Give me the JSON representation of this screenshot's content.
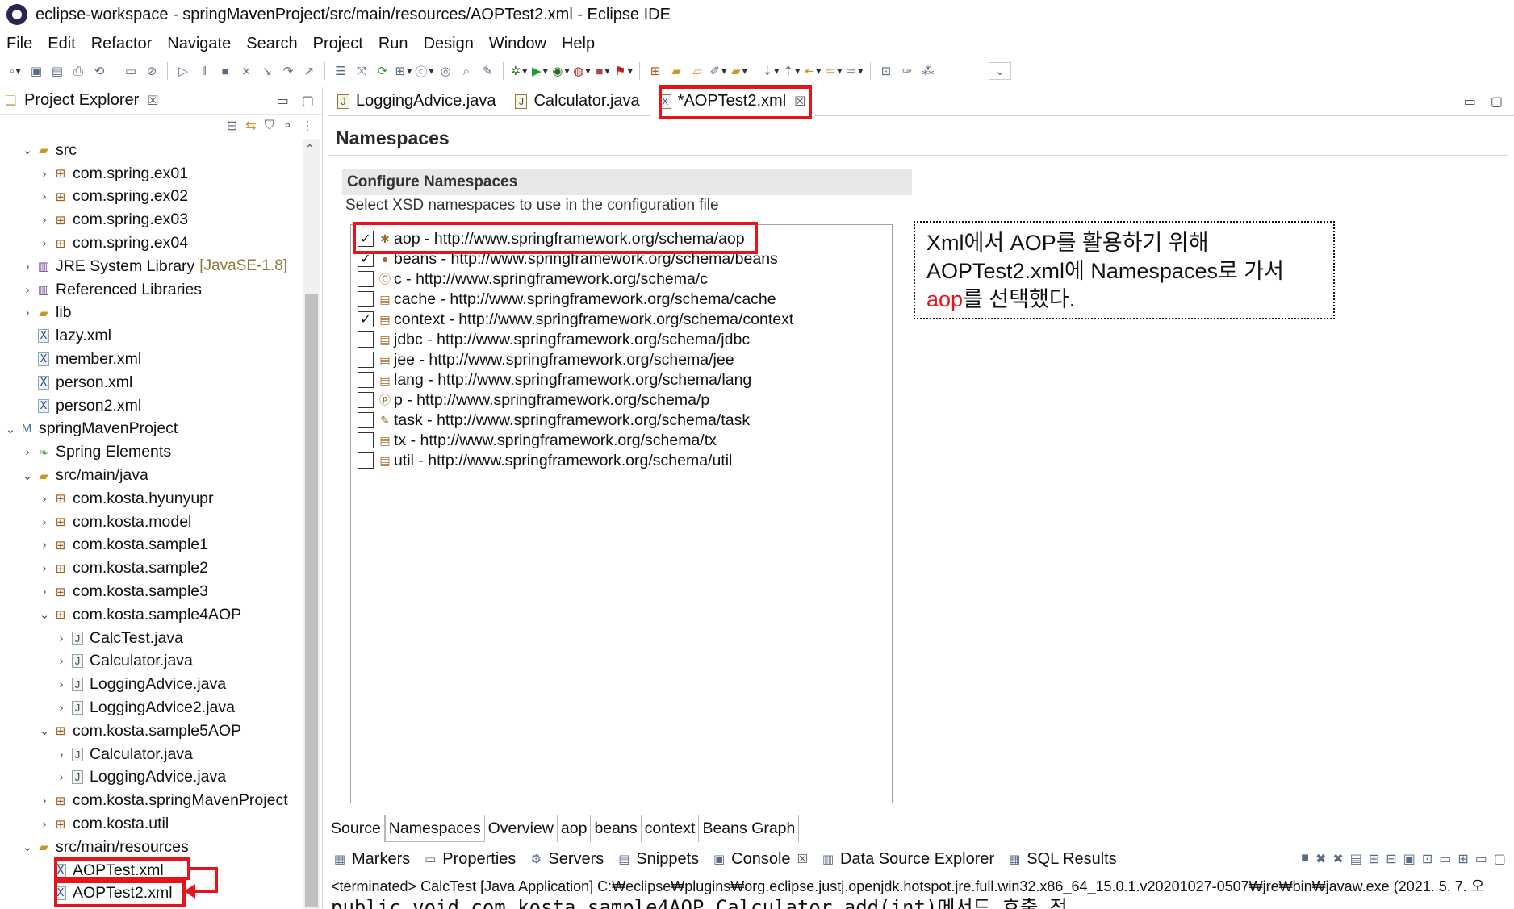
{
  "window": {
    "title": "eclipse-workspace - springMavenProject/src/main/resources/AOPTest2.xml - Eclipse IDE"
  },
  "menu": [
    "File",
    "Edit",
    "Refactor",
    "Navigate",
    "Search",
    "Project",
    "Run",
    "Design",
    "Window",
    "Help"
  ],
  "project_explorer": {
    "title": "Project Explorer",
    "close": "☒",
    "minimize": "▭",
    "maximize": "▢",
    "tree": [
      {
        "arrow": "⌄",
        "icon": "folder-icon",
        "label": "src",
        "level": 1
      },
      {
        "arrow": "›",
        "icon": "package-icon",
        "label": "com.spring.ex01",
        "level": 2
      },
      {
        "arrow": "›",
        "icon": "package-icon",
        "label": "com.spring.ex02",
        "level": 2
      },
      {
        "arrow": "›",
        "icon": "package-icon",
        "label": "com.spring.ex03",
        "level": 2
      },
      {
        "arrow": "›",
        "icon": "package-icon",
        "label": "com.spring.ex04",
        "level": 2
      },
      {
        "arrow": "›",
        "icon": "library-icon",
        "label": "JRE System Library",
        "deco": "[JavaSE-1.8]",
        "level": 1
      },
      {
        "arrow": "›",
        "icon": "library-icon",
        "label": "Referenced Libraries",
        "level": 1
      },
      {
        "arrow": "›",
        "icon": "folder-icon",
        "label": "lib",
        "level": 1
      },
      {
        "arrow": "",
        "icon": "xml-file-icon",
        "label": "lazy.xml",
        "level": 1
      },
      {
        "arrow": "",
        "icon": "xml-file-icon",
        "label": "member.xml",
        "level": 1
      },
      {
        "arrow": "",
        "icon": "xml-file-icon",
        "label": "person.xml",
        "level": 1
      },
      {
        "arrow": "",
        "icon": "xml-file-icon",
        "label": "person2.xml",
        "level": 1
      },
      {
        "arrow": "⌄",
        "icon": "project-icon",
        "label": "springMavenProject",
        "level": 0
      },
      {
        "arrow": "›",
        "icon": "spring-icon",
        "label": "Spring Elements",
        "level": 1
      },
      {
        "arrow": "⌄",
        "icon": "source-folder-icon",
        "label": "src/main/java",
        "level": 1
      },
      {
        "arrow": "›",
        "icon": "package-icon",
        "label": "com.kosta.hyunyupr",
        "level": 2
      },
      {
        "arrow": "›",
        "icon": "package-icon",
        "label": "com.kosta.model",
        "level": 2
      },
      {
        "arrow": "›",
        "icon": "package-icon",
        "label": "com.kosta.sample1",
        "level": 2
      },
      {
        "arrow": "›",
        "icon": "package-icon",
        "label": "com.kosta.sample2",
        "level": 2
      },
      {
        "arrow": "›",
        "icon": "package-icon",
        "label": "com.kosta.sample3",
        "level": 2
      },
      {
        "arrow": "⌄",
        "icon": "package-icon",
        "label": "com.kosta.sample4AOP",
        "level": 2
      },
      {
        "arrow": "›",
        "icon": "java-file-icon",
        "label": "CalcTest.java",
        "level": 3
      },
      {
        "arrow": "›",
        "icon": "java-file-icon",
        "label": "Calculator.java",
        "level": 3
      },
      {
        "arrow": "›",
        "icon": "java-file-icon",
        "label": "LoggingAdvice.java",
        "level": 3
      },
      {
        "arrow": "›",
        "icon": "java-file-icon",
        "label": "LoggingAdvice2.java",
        "level": 3
      },
      {
        "arrow": "⌄",
        "icon": "package-icon",
        "label": "com.kosta.sample5AOP",
        "level": 2
      },
      {
        "arrow": "›",
        "icon": "java-file-icon",
        "label": "Calculator.java",
        "level": 3
      },
      {
        "arrow": "›",
        "icon": "java-file-icon",
        "label": "LoggingAdvice.java",
        "level": 3
      },
      {
        "arrow": "›",
        "icon": "package-icon",
        "label": "com.kosta.springMavenProject",
        "level": 2
      },
      {
        "arrow": "›",
        "icon": "package-icon",
        "label": "com.kosta.util",
        "level": 2
      },
      {
        "arrow": "⌄",
        "icon": "source-folder-icon",
        "label": "src/main/resources",
        "level": 1
      },
      {
        "arrow": "",
        "icon": "xml-file-icon",
        "label": "AOPTest.xml",
        "level": 2
      },
      {
        "arrow": "",
        "icon": "xml-file-icon",
        "label": "AOPTest2.xml",
        "level": 2
      }
    ]
  },
  "editor": {
    "tabs": [
      {
        "label": "LoggingAdvice.java",
        "icon": "java-file-icon"
      },
      {
        "label": "Calculator.java",
        "icon": "java-file-icon"
      },
      {
        "label": "*AOPTest2.xml",
        "icon": "xml-file-icon",
        "close": "☒"
      }
    ],
    "minimize": "▭",
    "maximize": "▢",
    "page_title": "Namespaces",
    "section_title": "Configure Namespaces",
    "section_desc": "Select XSD namespaces to use in the configuration file",
    "namespaces": [
      {
        "checked": true,
        "icon": "aop-namespace-icon",
        "text": "aop - http://www.springframework.org/schema/aop"
      },
      {
        "checked": true,
        "icon": "beans-namespace-icon",
        "text": "beans - http://www.springframework.org/schema/beans"
      },
      {
        "checked": false,
        "icon": "c-namespace-icon",
        "text": "c - http://www.springframework.org/schema/c"
      },
      {
        "checked": false,
        "icon": "cache-namespace-icon",
        "text": "cache - http://www.springframework.org/schema/cache"
      },
      {
        "checked": true,
        "icon": "context-namespace-icon",
        "text": "context - http://www.springframework.org/schema/context"
      },
      {
        "checked": false,
        "icon": "jdbc-namespace-icon",
        "text": "jdbc - http://www.springframework.org/schema/jdbc"
      },
      {
        "checked": false,
        "icon": "jee-namespace-icon",
        "text": "jee - http://www.springframework.org/schema/jee"
      },
      {
        "checked": false,
        "icon": "lang-namespace-icon",
        "text": "lang - http://www.springframework.org/schema/lang"
      },
      {
        "checked": false,
        "icon": "p-namespace-icon",
        "text": "p - http://www.springframework.org/schema/p"
      },
      {
        "checked": false,
        "icon": "task-namespace-icon",
        "text": "task - http://www.springframework.org/schema/task"
      },
      {
        "checked": false,
        "icon": "tx-namespace-icon",
        "text": "tx - http://www.springframework.org/schema/tx"
      },
      {
        "checked": false,
        "icon": "util-namespace-icon",
        "text": "util - http://www.springframework.org/schema/util"
      }
    ],
    "bottom_tabs": [
      "Source",
      "Namespaces",
      "Overview",
      "aop",
      "beans",
      "context",
      "Beans Graph"
    ],
    "active_bottom_tab": "Namespaces"
  },
  "annotation": {
    "line1": "Xml에서 AOP를 활용하기 위해",
    "line2": "AOPTest2.xml에 Namespaces로 가서",
    "line3_red": "aop",
    "line3_rest": "를 선택했다."
  },
  "console": {
    "tabs": [
      {
        "label": "Markers",
        "icon": "markers-icon"
      },
      {
        "label": "Properties",
        "icon": "properties-icon"
      },
      {
        "label": "Servers",
        "icon": "servers-icon"
      },
      {
        "label": "Snippets",
        "icon": "snippets-icon"
      },
      {
        "label": "Console",
        "icon": "console-icon",
        "close": "☒"
      },
      {
        "label": "Data Source Explorer",
        "icon": "data-source-icon"
      },
      {
        "label": "SQL Results",
        "icon": "sql-results-icon"
      }
    ],
    "status_line": "<terminated> CalcTest [Java Application] C:₩eclipse₩plugins₩org.eclipse.justj.openjdk.hotspot.jre.full.win32.x86_64_15.0.1.v20201027-0507₩jre₩bin₩javaw.exe  (2021. 5. 7. 오",
    "output_line": "public void com.kosta.sample4AOP.Calculator.add(int)메서드 호출 전"
  },
  "colors": {
    "highlight_red": "#e8141c",
    "section_bg": "#e8e8e8"
  }
}
